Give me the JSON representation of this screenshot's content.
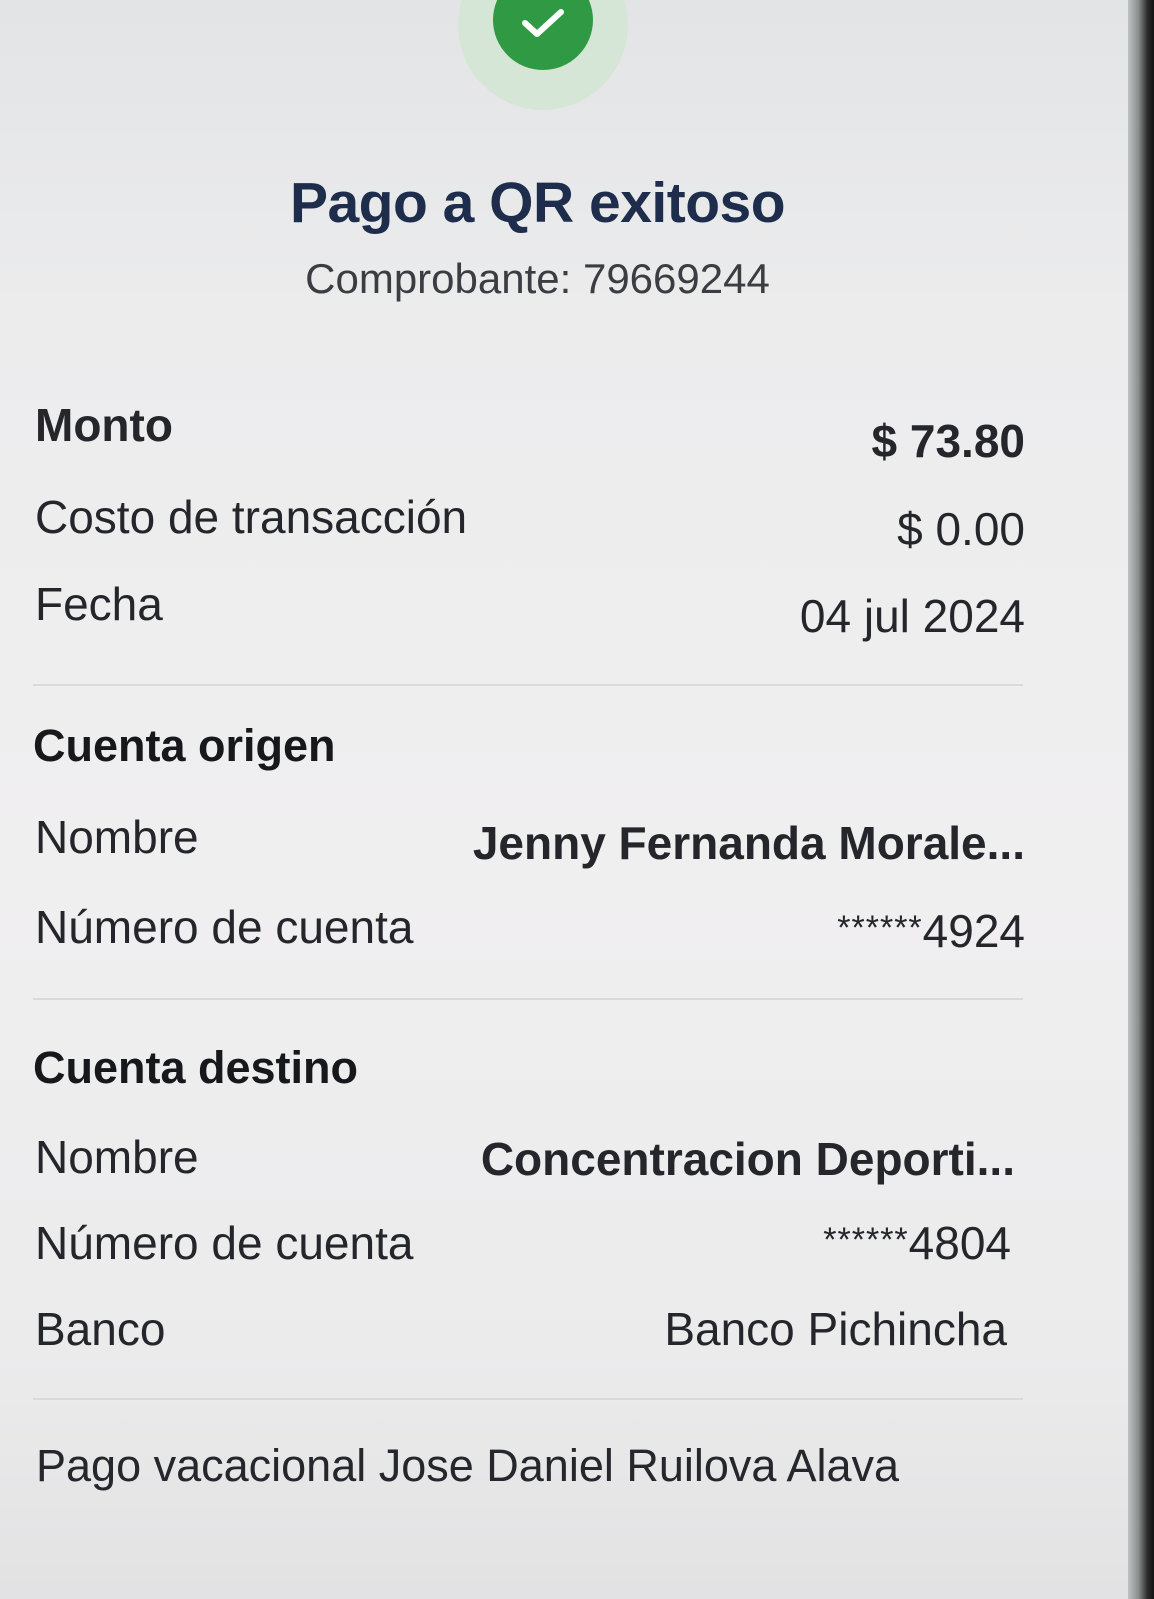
{
  "header": {
    "title": "Pago a QR exitoso",
    "receipt_label": "Comprobante:",
    "receipt_number": "79669244",
    "status_icon": "checkmark-icon",
    "accent_color": "#2f9a43"
  },
  "summary": {
    "amount_label": "Monto",
    "amount_value": "$ 73.80",
    "fee_label": "Costo de transacción",
    "fee_value": "$ 0.00",
    "date_label": "Fecha",
    "date_value": "04 jul 2024"
  },
  "origin_account": {
    "heading": "Cuenta origen",
    "name_label": "Nombre",
    "name_value": "Jenny Fernanda Morale...",
    "number_label": "Número de cuenta",
    "number_mask": "******",
    "number_suffix": "4924"
  },
  "destination_account": {
    "heading": "Cuenta destino",
    "name_label": "Nombre",
    "name_value": "Concentracion Deporti...",
    "number_label": "Número de cuenta",
    "number_mask": "******",
    "number_suffix": "4804",
    "bank_label": "Banco",
    "bank_value": "Banco Pichincha"
  },
  "memo": "Pago vacacional Jose Daniel Ruilova Alava"
}
